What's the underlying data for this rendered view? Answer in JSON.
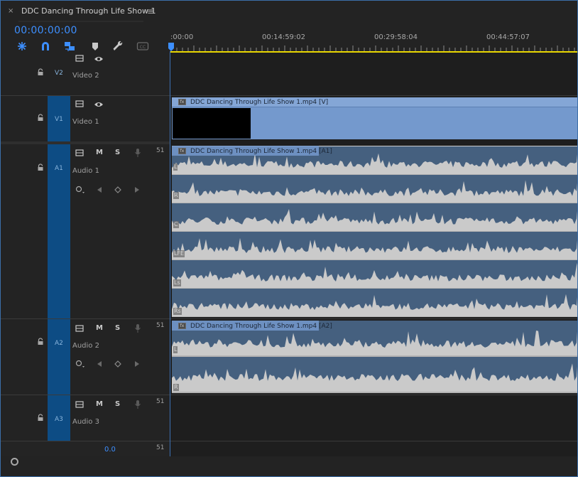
{
  "tab": {
    "close_glyph": "×",
    "title": "DDC Dancing Through Life Show 1",
    "menu_glyph": "≡"
  },
  "timecode": "00:00:00:00",
  "toolbar": {
    "icons": [
      "snap-icon",
      "magnet-icon",
      "linked-selection-icon",
      "marker-icon",
      "wrench-icon",
      "captions-icon"
    ]
  },
  "ruler": {
    "labels": [
      ":00:00",
      "00:14:59:02",
      "00:29:58:04",
      "00:44:57:07"
    ]
  },
  "tracks": {
    "v2": {
      "target": "V2",
      "name": "Video 2"
    },
    "v1": {
      "target": "V1",
      "name": "Video 1"
    },
    "a1": {
      "target": "A1",
      "name": "Audio 1",
      "channels": "51",
      "mute": "M",
      "solo": "S"
    },
    "a2": {
      "target": "A2",
      "name": "Audio 2",
      "channels": "51",
      "mute": "M",
      "solo": "S"
    },
    "a3": {
      "target": "A3",
      "name": "Audio 3",
      "channels": "51",
      "mute": "M",
      "solo": "S"
    }
  },
  "master": {
    "volume": "0.0",
    "channels": "51"
  },
  "clips": {
    "v1": {
      "fx": "fx",
      "label": "DDC Dancing Through Life Show 1.mp4 [V]"
    },
    "a1": {
      "fx": "fx",
      "label": "DDC Dancing Through Life Show 1.mp4 [A1]",
      "channel_labels": [
        "L",
        "R",
        "C",
        "LFE",
        "Ls",
        "Rs"
      ]
    },
    "a2": {
      "fx": "fx",
      "label": "DDC Dancing Through Life Show 1.mp4 [A2]",
      "channel_labels": [
        "L",
        "R"
      ]
    }
  },
  "colors": {
    "accent": "#3d8fff",
    "track_target": "#0d4c84",
    "video_clip": "#7499cd",
    "audio_clip": "#cacaca",
    "audio_wave": "#45607f",
    "ruler_work_area": "#e8d600"
  }
}
